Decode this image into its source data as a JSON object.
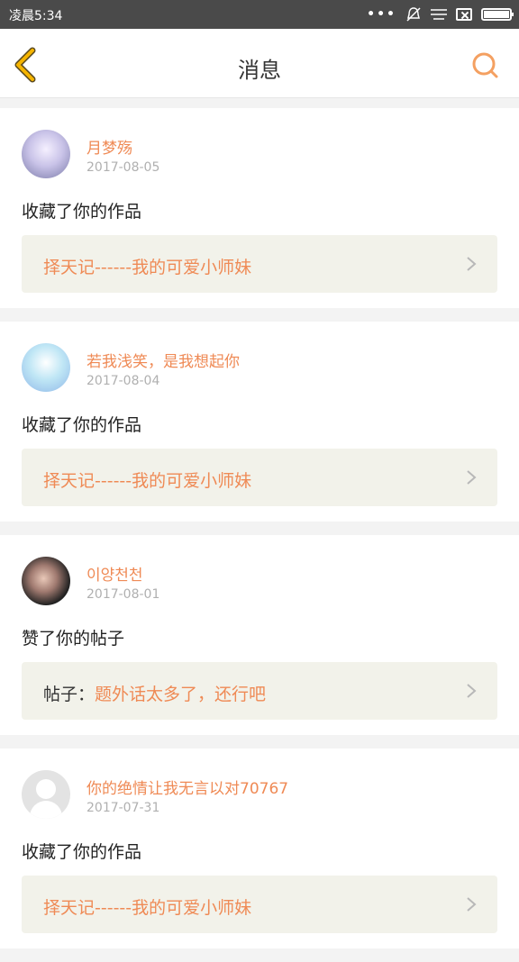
{
  "status_bar": {
    "time": "凌晨5:34",
    "dots": "•••",
    "icons": [
      "dots-icon",
      "bell-muted-icon",
      "menu-lines-icon",
      "close-box-icon",
      "battery-icon"
    ]
  },
  "nav": {
    "title": "消息",
    "back_icon": "chevron-left-icon",
    "search_icon": "search-icon"
  },
  "colors": {
    "accent": "#ef8a55",
    "back_icon": "#f5b400",
    "search_icon": "#f4a061",
    "link_bg": "#f2f2ea",
    "date": "#b0b0b0"
  },
  "messages": [
    {
      "username": "月梦殇",
      "date": "2017-08-05",
      "action": "收藏了你的作品",
      "link_prefix": "",
      "link_text": "择天记------我的可爱小师妹"
    },
    {
      "username": "若我浅笑，是我想起你",
      "date": "2017-08-04",
      "action": "收藏了你的作品",
      "link_prefix": "",
      "link_text": "择天记------我的可爱小师妹"
    },
    {
      "username": "이양천천",
      "date": "2017-08-01",
      "action": "赞了你的帖子",
      "link_prefix": "帖子：",
      "link_text": "题外话太多了，还行吧"
    },
    {
      "username": "你的绝情让我无言以对70767",
      "date": "2017-07-31",
      "action": "收藏了你的作品",
      "link_prefix": "",
      "link_text": "择天记------我的可爱小师妹"
    }
  ]
}
